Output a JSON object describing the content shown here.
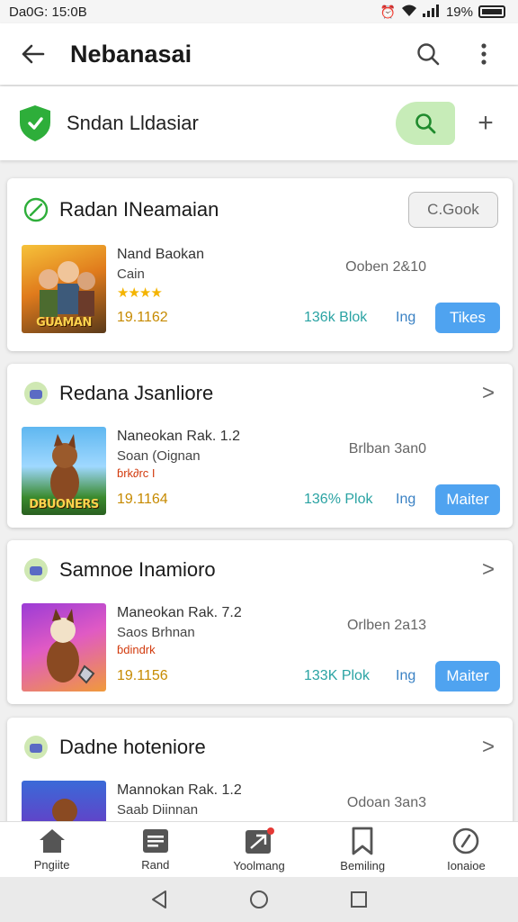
{
  "status_bar": {
    "time": "Da0G: 15:0B",
    "battery": "19%"
  },
  "app_bar": {
    "title": "Nebanasai"
  },
  "search_card": {
    "label": "Sndan Lldasiar"
  },
  "cards": [
    {
      "title": "Radan INeamaian",
      "button_label": "C.Gook",
      "thumb_text": "GUAMAN",
      "game_name": "Nand Baokan",
      "game_sub": "Cain",
      "stars": "★★★★",
      "date": "Ooben 2&10",
      "count": "19.1162",
      "size": "136k Blok",
      "lang": "Ing",
      "action": "Tikes"
    },
    {
      "title": "Redana Jsanliore",
      "thumb_text": "DBUONERS",
      "game_name": "Naneokan Rak. 1.2",
      "game_sub": "Soan (Oignan",
      "stars": "ɓrk∂rc I",
      "date": "Brlban 3an0",
      "count": "19.1164",
      "size": "136% Plok",
      "lang": "Ing",
      "action": "Maiter"
    },
    {
      "title": "Samnoe Inamioro",
      "game_name": "Maneokan Rak. 7.2",
      "game_sub": "Saos Brhnan",
      "stars": "ɓdindrk",
      "date": "Orlben 2a13",
      "count": "19.1156",
      "size": "133K Plok",
      "lang": "Ing",
      "action": "Maiter"
    },
    {
      "title": "Dadne hoteniore",
      "game_name": "Mannokan Rak. 1.2",
      "game_sub": "Saab Diinnan",
      "date": "Odoan 3an3"
    }
  ],
  "bottom_nav": [
    {
      "label": "Pngiite",
      "icon": "home-icon"
    },
    {
      "label": "Rand",
      "icon": "list-icon"
    },
    {
      "label": "Yoolmang",
      "icon": "game-icon"
    },
    {
      "label": "Bemiling",
      "icon": "bookmark-icon"
    },
    {
      "label": "Ionaioe",
      "icon": "profile-icon"
    }
  ],
  "colors": {
    "accent": "#4fa3f0",
    "green": "#2eae3a",
    "search_pill": "#c7ecb8"
  }
}
